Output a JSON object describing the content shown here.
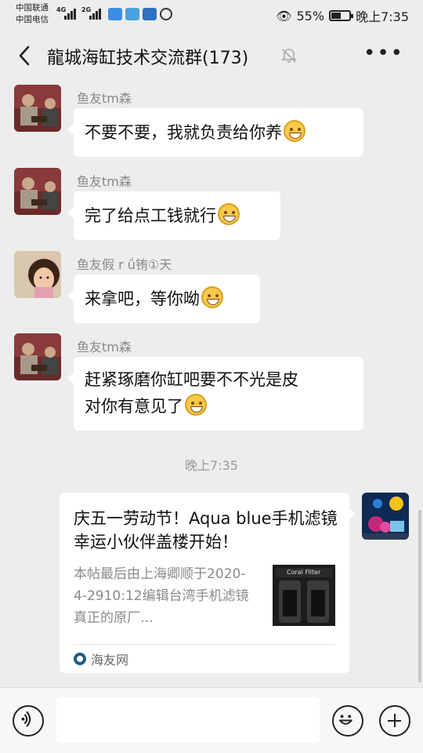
{
  "status_bar": {
    "carrier_1": "中国联通",
    "carrier_2": "中国电信",
    "network_1": "4G",
    "network_2": "2G",
    "battery": "55%",
    "battery_level": 0.55,
    "time": "晚上7:35"
  },
  "header": {
    "title": "龍城海缸技术交流群(173)",
    "back_icon": "chevron-left-icon",
    "mute_icon": "bell-off-icon",
    "more_icon": "more-icon"
  },
  "messages": [
    {
      "sender": "鱼友tm森",
      "text": "不要不要，我就负责给你养",
      "emoji": "grin-emoji"
    },
    {
      "sender": "鱼友tm森",
      "text": "完了给点工钱就行",
      "emoji": "grin-emoji"
    },
    {
      "sender": "鱼友假 r ǘ铕①天",
      "text": "来拿吧，等你呦",
      "emoji": "grin-emoji"
    },
    {
      "sender": "鱼友tm森",
      "text_line1": "赶紧琢磨你缸吧要不不光是皮",
      "text_line2": "对你有意见了",
      "emoji": "laugh-cry-emoji"
    }
  ],
  "timestamp": "晚上7:35",
  "link_card": {
    "title": "庆五一劳动节！Aqua blue手机滤镜幸运小伙伴盖楼开始！",
    "description": "本帖最后由上海卿顺于2020-4-2910:12编辑台湾手机滤镜真正的原厂…",
    "thumbnail_label": "Coral Filter",
    "source": "海友网"
  },
  "input_bar": {
    "voice_icon": "voice-icon",
    "emoji_icon": "smiley-icon",
    "plus_icon": "plus-icon"
  },
  "colors": {
    "background": "#ededed",
    "bubble": "#ffffff",
    "sender_text": "#888888",
    "timestamp_text": "#9a9a9a"
  }
}
